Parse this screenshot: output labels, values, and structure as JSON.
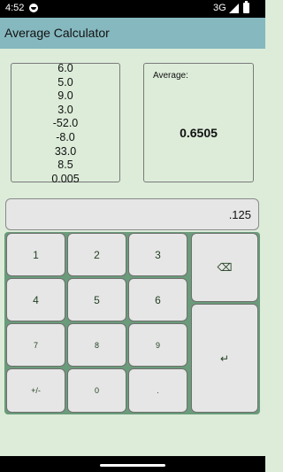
{
  "status_bar": {
    "time": "4:52",
    "network": "3G"
  },
  "title_bar": {
    "title": "Average Calculator"
  },
  "numbers": [
    "6.0",
    "5.0",
    "9.0",
    "3.0",
    "-52.0",
    "-8.0",
    "33.0",
    "8.5",
    "0.005"
  ],
  "average": {
    "label": "Average:",
    "value": "0.6505"
  },
  "display": {
    "value": ".125"
  },
  "keypad": {
    "k1": "1",
    "k2": "2",
    "k3": "3",
    "k4": "4",
    "k5": "5",
    "k6": "6",
    "k7": "7",
    "k8": "8",
    "k9": "9",
    "plus_minus": "+/-",
    "k0": "0",
    "decimal": ".",
    "backspace": "⌫",
    "enter": "↵"
  }
}
